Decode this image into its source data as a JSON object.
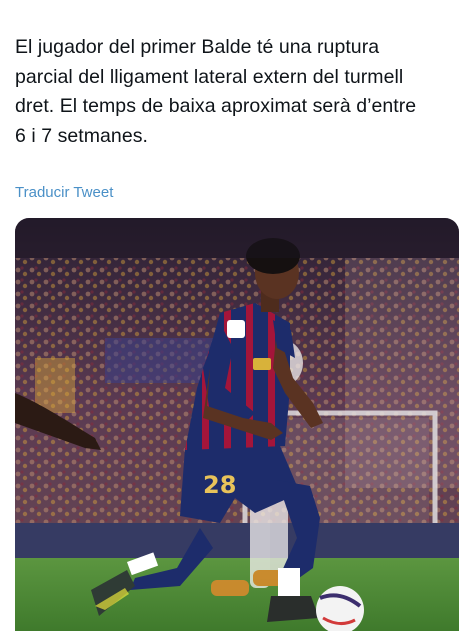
{
  "tweet": {
    "text_lines": [
      "El jugador del primer Balde té una ruptura",
      "parcial del lligament lateral extern del turmell",
      "dret. El temps de baixa aproximat serà d’entre",
      "6 i 7 setmanes."
    ],
    "translate_label": "Traducir Tweet"
  },
  "media": {
    "alt": "Football player in blue and red striped kit dribbling a ball on a pitch",
    "jersey_number": "28",
    "colors": {
      "pitch": "#4f8a35",
      "kit_blue": "#1d2c6b",
      "kit_red": "#a4153a",
      "link": "#4a90c7"
    }
  }
}
